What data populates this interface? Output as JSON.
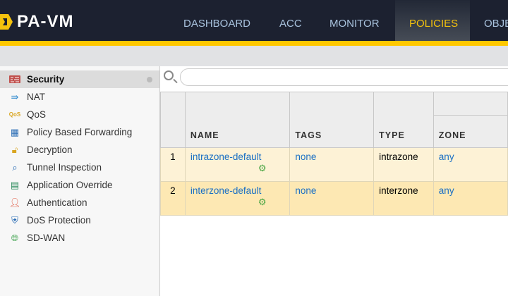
{
  "app": {
    "title": "PA-VM"
  },
  "nav": [
    {
      "label": "DASHBOARD"
    },
    {
      "label": "ACC"
    },
    {
      "label": "MONITOR"
    },
    {
      "label": "POLICIES",
      "active": true
    },
    {
      "label": "OBJE"
    }
  ],
  "colors": {
    "header": "#1c2130",
    "accent": "#ffc800",
    "active_tab_text": "#f4c20d",
    "link": "#1a6fc4"
  },
  "sidebar": {
    "items": [
      {
        "label": "Security",
        "icon": "firewall-icon",
        "selected": true
      },
      {
        "label": "NAT",
        "icon": "nat-arrow-icon"
      },
      {
        "label": "QoS",
        "icon": "qos-icon"
      },
      {
        "label": "Policy Based Forwarding",
        "icon": "pbf-icon"
      },
      {
        "label": "Decryption",
        "icon": "unlock-icon"
      },
      {
        "label": "Tunnel Inspection",
        "icon": "tunnel-inspection-icon"
      },
      {
        "label": "Application Override",
        "icon": "app-override-icon"
      },
      {
        "label": "Authentication",
        "icon": "authentication-icon"
      },
      {
        "label": "DoS Protection",
        "icon": "dos-shield-icon"
      },
      {
        "label": "SD-WAN",
        "icon": "sdwan-globe-icon"
      }
    ]
  },
  "search": {
    "placeholder": "",
    "value": ""
  },
  "table": {
    "columns": [
      "",
      "NAME",
      "TAGS",
      "TYPE",
      "ZONE"
    ],
    "rows": [
      {
        "num": "1",
        "name": "intrazone-default",
        "tags": "none",
        "type": "intrazone",
        "zone": "any"
      },
      {
        "num": "2",
        "name": "interzone-default",
        "tags": "none",
        "type": "interzone",
        "zone": "any"
      }
    ]
  }
}
